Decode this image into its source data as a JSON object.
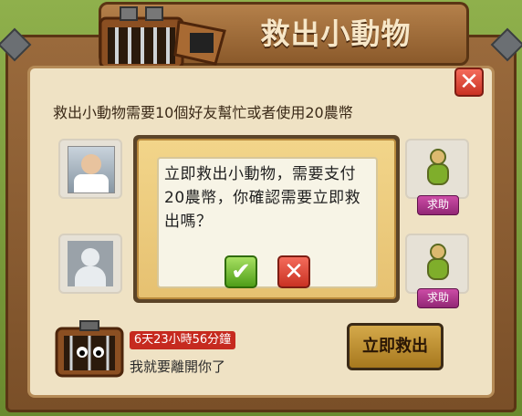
{
  "title": "救出小動物",
  "instruction": "救出小動物需要10個好友幫忙或者使用20農幣",
  "friends": [
    {
      "type": "photo",
      "help_label": ""
    },
    {
      "type": "silhouette",
      "help_label": ""
    }
  ],
  "helpers": [
    {
      "help_label": "求助"
    },
    {
      "help_label": "求助"
    }
  ],
  "dialog": {
    "message": "立即救出小動物，需要支付20農幣，你確認需要立即救出嗎？",
    "confirm_icon": "check-icon",
    "cancel_icon": "x-icon"
  },
  "bottom": {
    "timer": "6天23小時56分鐘",
    "leave_text": "我就要離開你了",
    "rescue_button": "立即救出"
  },
  "colors": {
    "close": "#c93223",
    "confirm": "#4f9e18",
    "help": "#922775",
    "timer": "#c62a1f",
    "rescue": "#d4a94a"
  }
}
